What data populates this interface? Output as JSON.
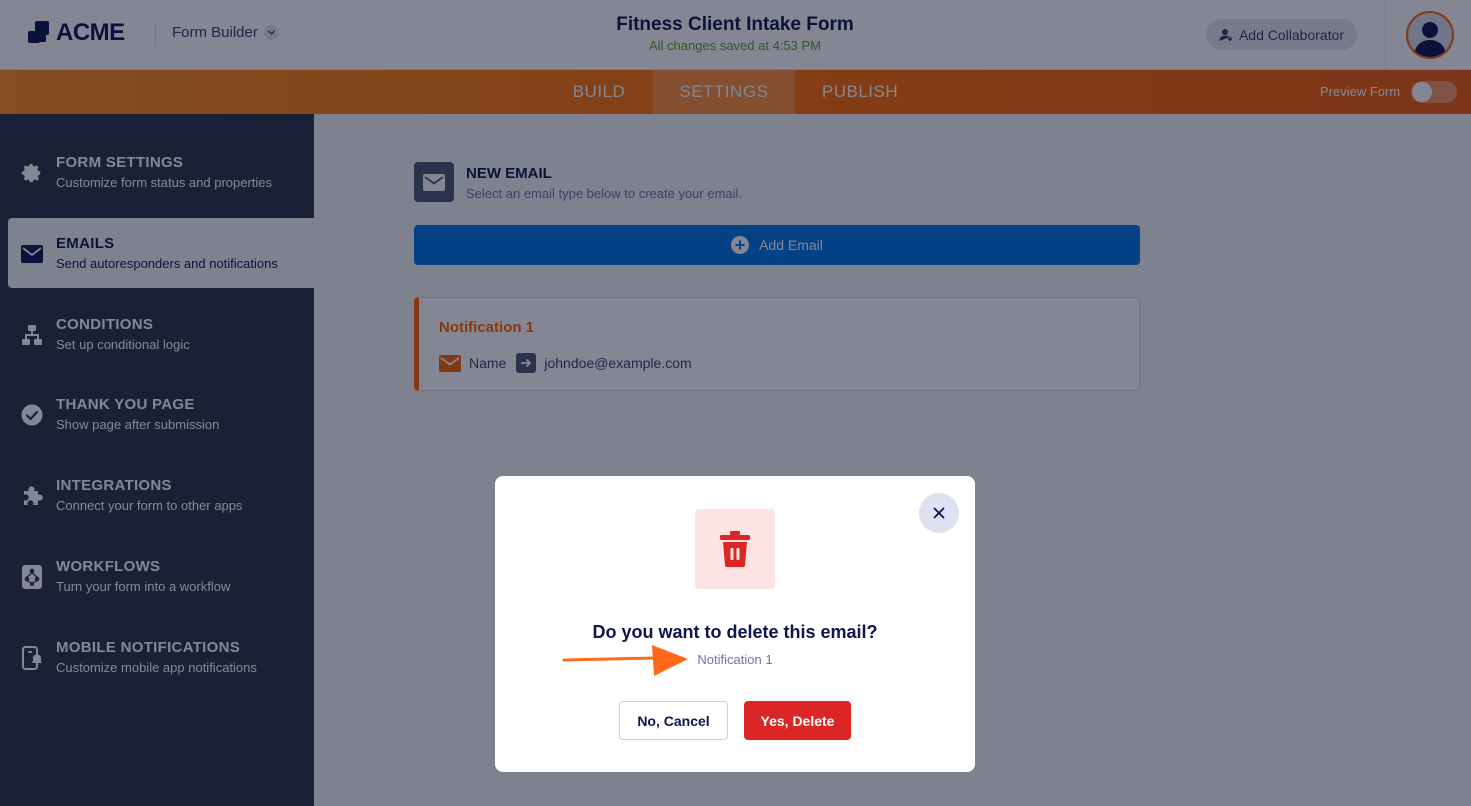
{
  "header": {
    "logo_text": "ACME",
    "app_switcher_label": "Form Builder",
    "form_title": "Fitness Client Intake Form",
    "save_status": "All changes saved at 4:53 PM",
    "collaborator_button": "Add Collaborator"
  },
  "nav": {
    "tabs": [
      "BUILD",
      "SETTINGS",
      "PUBLISH"
    ],
    "active_tab": "SETTINGS",
    "preview_label": "Preview Form",
    "preview_enabled": false
  },
  "sidebar": {
    "items": [
      {
        "title": "FORM SETTINGS",
        "desc": "Customize form status and properties",
        "icon": "gear-icon"
      },
      {
        "title": "EMAILS",
        "desc": "Send autoresponders and notifications",
        "icon": "envelope-icon"
      },
      {
        "title": "CONDITIONS",
        "desc": "Set up conditional logic",
        "icon": "hierarchy-icon"
      },
      {
        "title": "THANK YOU PAGE",
        "desc": "Show page after submission",
        "icon": "check-circle-icon"
      },
      {
        "title": "INTEGRATIONS",
        "desc": "Connect your form to other apps",
        "icon": "puzzle-icon"
      },
      {
        "title": "WORKFLOWS",
        "desc": "Turn your form into a workflow",
        "icon": "workflow-icon"
      },
      {
        "title": "MOBILE NOTIFICATIONS",
        "desc": "Customize mobile app notifications",
        "icon": "mobile-bell-icon"
      }
    ],
    "active_index": 1
  },
  "main": {
    "new_email_title": "NEW EMAIL",
    "new_email_subtitle": "Select an email type below to create your email.",
    "add_email_button": "Add Email",
    "notification": {
      "title": "Notification 1",
      "from_label": "Name",
      "to_address": "johndoe@example.com"
    }
  },
  "modal": {
    "question": "Do you want to delete this email?",
    "target_name": "Notification 1",
    "cancel_label": "No, Cancel",
    "confirm_label": "Yes, Delete"
  },
  "colors": {
    "brand_orange": "#ff6100",
    "primary_blue": "#0075e3",
    "danger_red": "#dc2626",
    "sidebar_bg": "#2b3245",
    "navy_text": "#0a1551"
  }
}
